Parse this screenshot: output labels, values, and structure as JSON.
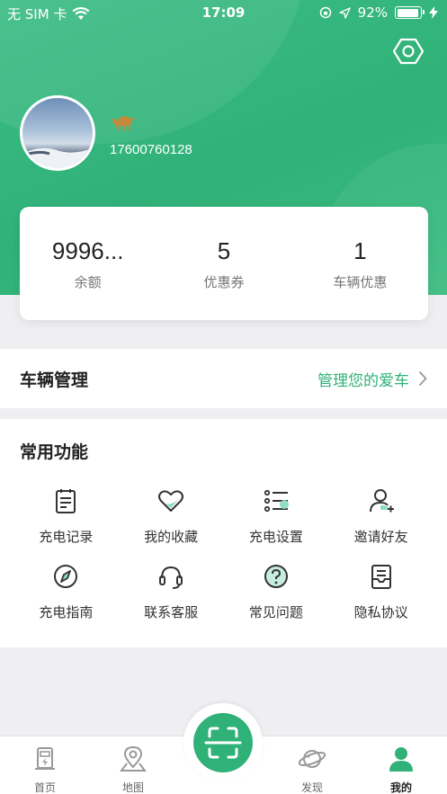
{
  "status_bar": {
    "carrier": "无 SIM 卡",
    "time": "17:09",
    "battery": "92%",
    "battery_level": 0.92
  },
  "profile": {
    "phone": "17600760128"
  },
  "stats": [
    {
      "value": "9996...",
      "label": "余额"
    },
    {
      "value": "5",
      "label": "优惠券"
    },
    {
      "value": "1",
      "label": "车辆优惠"
    }
  ],
  "vehicle": {
    "title": "车辆管理",
    "link": "管理您的爱车"
  },
  "functions": {
    "title": "常用功能",
    "items": [
      {
        "label": "充电记录",
        "icon": "charge-record-icon"
      },
      {
        "label": "我的收藏",
        "icon": "heart-icon"
      },
      {
        "label": "充电设置",
        "icon": "list-settings-icon"
      },
      {
        "label": "邀请好友",
        "icon": "invite-user-icon"
      },
      {
        "label": "充电指南",
        "icon": "compass-icon"
      },
      {
        "label": "联系客服",
        "icon": "headset-icon"
      },
      {
        "label": "常见问题",
        "icon": "question-icon"
      },
      {
        "label": "隐私协议",
        "icon": "document-icon"
      }
    ]
  },
  "tabbar": {
    "items": [
      {
        "label": "首页",
        "icon": "charger-icon"
      },
      {
        "label": "地图",
        "icon": "map-pin-icon"
      },
      {
        "label": "发现",
        "icon": "planet-icon"
      },
      {
        "label": "我的",
        "icon": "user-icon"
      }
    ],
    "active_index": 3
  },
  "colors": {
    "brand_green": "#2fb178",
    "accent_light": "#8fdcc0"
  }
}
